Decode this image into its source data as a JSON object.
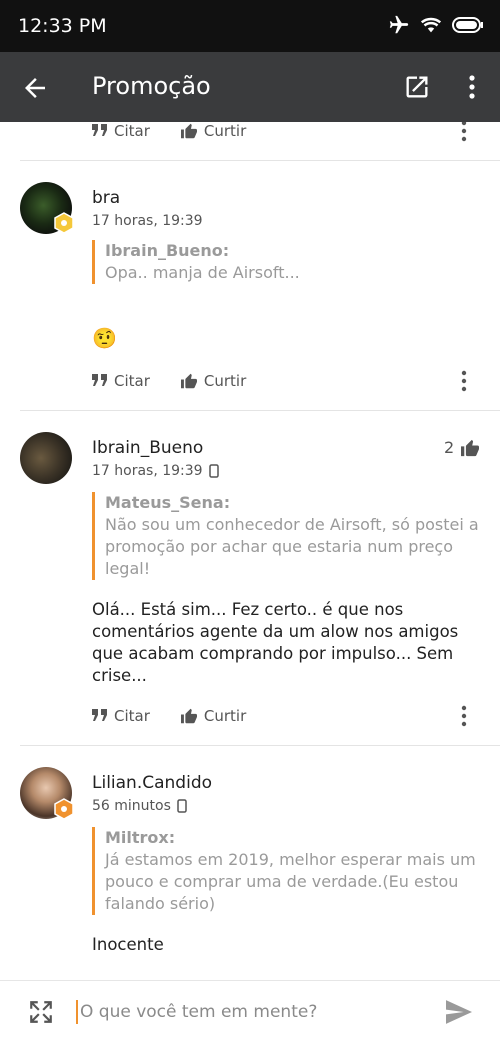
{
  "status": {
    "time": "12:33 PM"
  },
  "appbar": {
    "title": "Promoção"
  },
  "actions": {
    "quote_label": "Citar",
    "like_label": "Curtir"
  },
  "comments": [
    {
      "author": "bra",
      "time": "17 horas, 19:39",
      "quote_author": "Ibrain_Bueno:",
      "quote_text": "Opa.. manja de Airsoft...",
      "body": "",
      "emoji": "🤨"
    },
    {
      "author": "Ibrain_Bueno",
      "time": "17 horas, 19:39",
      "likes": "2",
      "quote_author": "Mateus_Sena:",
      "quote_text": "Não sou um conhecedor de Airsoft, só postei a promoção por achar que estaria num preço legal!",
      "body": "Olá... Está sim... Fez certo.. é que nos comentários agente da um alow nos amigos que acabam comprando por impulso... Sem crise..."
    },
    {
      "author": "Lilian.Candido",
      "time": "56 minutos",
      "quote_author": "Miltrox:",
      "quote_text": "Já estamos em 2019, melhor esperar mais um pouco e comprar uma de verdade.(Eu estou falando sério)",
      "body": "Inocente"
    }
  ],
  "composer": {
    "placeholder": "O que você tem em mente?"
  },
  "colors": {
    "accent": "#f0922e",
    "appbar": "#3a3b3d",
    "statusbar": "#111111"
  }
}
